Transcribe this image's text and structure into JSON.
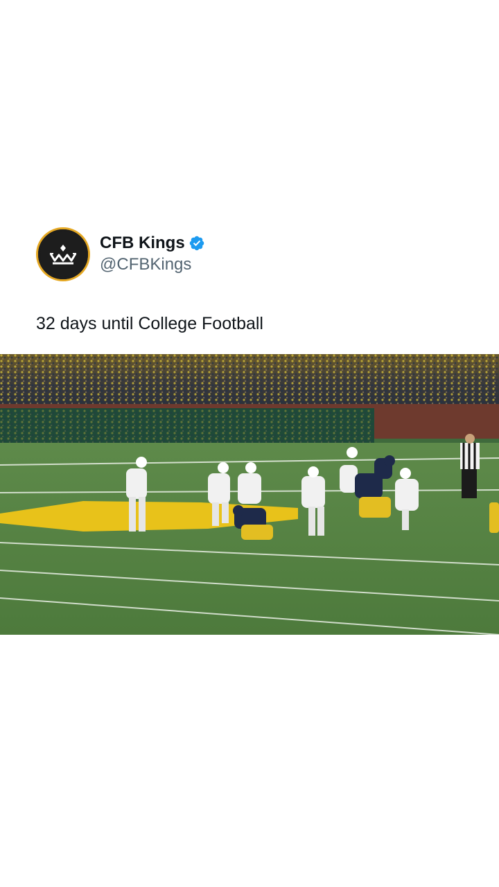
{
  "tweet": {
    "display_name": "CFB Kings",
    "handle": "@CFBKings",
    "verified": true,
    "text": "32 days until College Football",
    "avatar_icon": "crown-logo-icon",
    "verified_icon": "verified-badge-icon",
    "media": {
      "type": "video-frame",
      "description_icon": "football-field-image"
    }
  },
  "colors": {
    "background": "#ffffff",
    "name": "#0f1419",
    "handle": "#536471",
    "verified": "#1d9bf0",
    "avatar_ring": "#e5a823",
    "avatar_bg": "#1d1d1d"
  }
}
